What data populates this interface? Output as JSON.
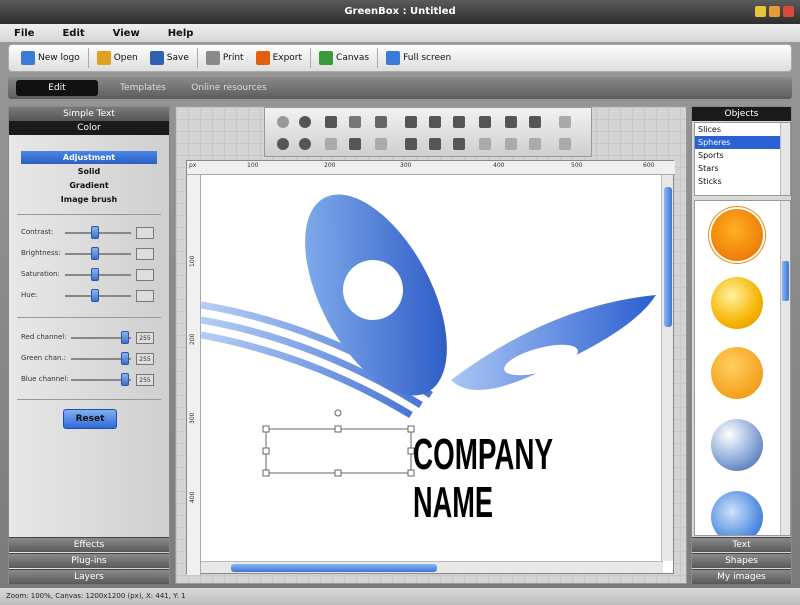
{
  "window": {
    "title": "GreenBox : Untitled"
  },
  "menu": [
    "File",
    "Edit",
    "View",
    "Help"
  ],
  "toolbar": [
    {
      "label": "New logo",
      "icon": "new-logo-icon",
      "color": "#3a7bd5"
    },
    {
      "label": "Open",
      "icon": "open-folder-icon",
      "color": "#e0a020"
    },
    {
      "label": "Save",
      "icon": "save-disk-icon",
      "color": "#3160b0"
    },
    {
      "label": "Print",
      "icon": "printer-icon",
      "color": "#8a8a8a"
    },
    {
      "label": "Export",
      "icon": "export-icon",
      "color": "#e06010"
    },
    {
      "label": "Canvas",
      "icon": "canvas-icon",
      "color": "#3a9a3a"
    },
    {
      "label": "Full screen",
      "icon": "full-screen-icon",
      "color": "#3a7bd5"
    }
  ],
  "tabs": [
    "Edit",
    "Templates",
    "Online resources"
  ],
  "left_panel": {
    "sections": [
      "Simple Text",
      "Color"
    ],
    "options": [
      "Adjustment",
      "Solid",
      "Gradient",
      "Image brush"
    ],
    "adjust_sliders": [
      {
        "label": "Contrast:",
        "value": "",
        "level": 0.5
      },
      {
        "label": "Brightness:",
        "value": "",
        "level": 0.5
      },
      {
        "label": "Saturation:",
        "value": "",
        "level": 0.5
      },
      {
        "label": "Hue:",
        "value": "",
        "level": 0.5
      }
    ],
    "channel_sliders": [
      {
        "label": "Red channel:",
        "value": "255",
        "level": 1
      },
      {
        "label": "Green chan.:",
        "value": "255",
        "level": 1
      },
      {
        "label": "Blue channel:",
        "value": "255",
        "level": 1
      }
    ],
    "reset_label": "Reset",
    "bottom": [
      "Effects",
      "Plug-ins",
      "Layers"
    ]
  },
  "canvas": {
    "ruler_unit": "px",
    "ruler_top": [
      "100",
      "200",
      "300",
      "400",
      "500",
      "600"
    ],
    "ruler_left": [
      "100",
      "200",
      "300",
      "400"
    ],
    "logo_text_1": "COMPANY",
    "logo_text_2": "NAME",
    "logo_color": "#2f6ad6"
  },
  "right_panel": {
    "header": "Objects",
    "list": [
      "Slices",
      "Spheres",
      "Sports",
      "Stars",
      "Sticks"
    ],
    "selected": "Spheres",
    "bottom": [
      "Text",
      "Shapes",
      "My images"
    ]
  },
  "status": "Zoom: 100%, Canvas: 1200x1200 (px), X: 441, Y: 1"
}
